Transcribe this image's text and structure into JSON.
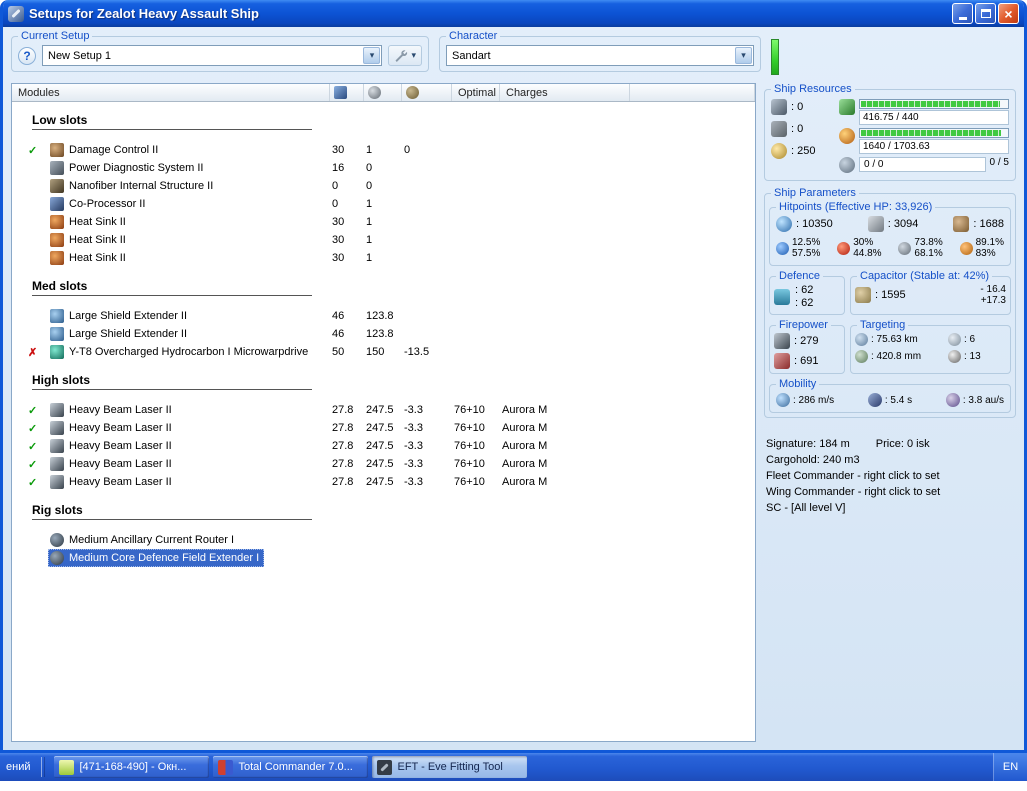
{
  "icons": {
    "close": "×",
    "dropdown_arrow": "▾",
    "help": "?",
    "check": "✓",
    "cross": "✗"
  },
  "window": {
    "title": "Setups for Zealot Heavy Assault Ship"
  },
  "toolbar": {
    "current_setup_label": "Current Setup",
    "current_setup_value": "New Setup 1",
    "character_label": "Character",
    "character_value": "Sandart"
  },
  "modules": {
    "header": {
      "title": "Modules",
      "optimal": "Optimal",
      "charges": "Charges"
    },
    "sections": [
      {
        "name": "Low slots",
        "rows": [
          {
            "status": "ok",
            "icon": "damage-control",
            "name": "Damage Control II",
            "cpu": "30",
            "pg": "1",
            "cap": "0",
            "optimal": "",
            "charge": ""
          },
          {
            "status": "",
            "icon": "power-diagnostic",
            "name": "Power Diagnostic System II",
            "cpu": "16",
            "pg": "0",
            "cap": "",
            "optimal": "",
            "charge": ""
          },
          {
            "status": "",
            "icon": "nanofiber",
            "name": "Nanofiber Internal Structure II",
            "cpu": "0",
            "pg": "0",
            "cap": "",
            "optimal": "",
            "charge": ""
          },
          {
            "status": "",
            "icon": "co-processor",
            "name": "Co-Processor II",
            "cpu": "0",
            "pg": "1",
            "cap": "",
            "optimal": "",
            "charge": ""
          },
          {
            "status": "",
            "icon": "heat-sink",
            "name": "Heat Sink II",
            "cpu": "30",
            "pg": "1",
            "cap": "",
            "optimal": "",
            "charge": ""
          },
          {
            "status": "",
            "icon": "heat-sink",
            "name": "Heat Sink II",
            "cpu": "30",
            "pg": "1",
            "cap": "",
            "optimal": "",
            "charge": ""
          },
          {
            "status": "",
            "icon": "heat-sink",
            "name": "Heat Sink II",
            "cpu": "30",
            "pg": "1",
            "cap": "",
            "optimal": "",
            "charge": ""
          }
        ]
      },
      {
        "name": "Med slots",
        "rows": [
          {
            "status": "",
            "icon": "shield-extender",
            "name": "Large Shield Extender II",
            "cpu": "46",
            "pg": "123.8",
            "cap": "",
            "optimal": "",
            "charge": ""
          },
          {
            "status": "",
            "icon": "shield-extender",
            "name": "Large Shield Extender II",
            "cpu": "46",
            "pg": "123.8",
            "cap": "",
            "optimal": "",
            "charge": ""
          },
          {
            "status": "error",
            "icon": "microwarpdrive",
            "name": "Y-T8 Overcharged Hydrocarbon I Microwarpdrive",
            "cpu": "50",
            "pg": "150",
            "cap": "-13.5",
            "optimal": "",
            "charge": ""
          }
        ]
      },
      {
        "name": "High slots",
        "rows": [
          {
            "status": "ok",
            "icon": "beam-laser",
            "name": "Heavy Beam Laser II",
            "cpu": "27.8",
            "pg": "247.5",
            "cap": "-3.3",
            "optimal": "76+10",
            "charge": "Aurora M"
          },
          {
            "status": "ok",
            "icon": "beam-laser",
            "name": "Heavy Beam Laser II",
            "cpu": "27.8",
            "pg": "247.5",
            "cap": "-3.3",
            "optimal": "76+10",
            "charge": "Aurora M"
          },
          {
            "status": "ok",
            "icon": "beam-laser",
            "name": "Heavy Beam Laser II",
            "cpu": "27.8",
            "pg": "247.5",
            "cap": "-3.3",
            "optimal": "76+10",
            "charge": "Aurora M"
          },
          {
            "status": "ok",
            "icon": "beam-laser",
            "name": "Heavy Beam Laser II",
            "cpu": "27.8",
            "pg": "247.5",
            "cap": "-3.3",
            "optimal": "76+10",
            "charge": "Aurora M"
          },
          {
            "status": "ok",
            "icon": "beam-laser",
            "name": "Heavy Beam Laser II",
            "cpu": "27.8",
            "pg": "247.5",
            "cap": "-3.3",
            "optimal": "76+10",
            "charge": "Aurora M"
          }
        ]
      },
      {
        "name": "Rig slots",
        "rows": [
          {
            "status": "",
            "icon": "rig",
            "name": "Medium Ancillary Current Router I",
            "cpu": "",
            "pg": "",
            "cap": "",
            "optimal": "",
            "charge": ""
          },
          {
            "status": "",
            "icon": "rig",
            "name": "Medium Core Defence Field Extender I",
            "cpu": "",
            "pg": "",
            "cap": "",
            "optimal": "",
            "charge": "",
            "selected": true
          }
        ]
      }
    ]
  },
  "resources": {
    "title": "Ship Resources",
    "turrets": ": 0",
    "launchers": ": 0",
    "calibration": ": 250",
    "cpu_text": "416.75 / 440",
    "pg_text": "1640 / 1703.63",
    "drone_text": "0 / 0",
    "drone_right": "0 / 5"
  },
  "parameters": {
    "title": "Ship Parameters",
    "hitpoints": {
      "title": "Hitpoints (Effective HP: 33,926)",
      "shield": ": 10350",
      "armor": ": 3094",
      "structure": ": 1688",
      "resists": [
        {
          "top": "12.5%",
          "bottom": "57.5%"
        },
        {
          "top": "30%",
          "bottom": "44.8%"
        },
        {
          "top": "73.8%",
          "bottom": "68.1%"
        },
        {
          "top": "89.1%",
          "bottom": "83%"
        }
      ]
    },
    "defence": {
      "title": "Defence",
      "v1": ": 62",
      "v2": ": 62"
    },
    "capacitor": {
      "title": "Capacitor (Stable at: 42%)",
      "amount": ": 1595",
      "drain": "- 16.4",
      "peak": "+17.3"
    },
    "firepower": {
      "title": "Firepower",
      "volley": ": 279",
      "dps": ": 691"
    },
    "targeting": {
      "title": "Targeting",
      "range": ": 75.63 km",
      "max_targets": ": 6",
      "scan_res": ": 420.8 mm",
      "sensor": ": 13"
    },
    "mobility": {
      "title": "Mobility",
      "speed": ": 286 m/s",
      "align": ": 5.4 s",
      "warp": ": 3.8 au/s"
    }
  },
  "footer": {
    "signature": "Signature: 184 m",
    "price": "Price: 0 isk",
    "cargohold": "Cargohold: 240 m3",
    "fleet": "Fleet Commander - right click to set",
    "wing": "Wing Commander - right click to set",
    "sc": "SC - [All level V]"
  },
  "taskbar": {
    "leftover": "ений",
    "buttons": [
      {
        "label": "[471-168-490] - Окн..."
      },
      {
        "label": "Total Commander 7.0..."
      },
      {
        "label": "EFT - Eve Fitting Tool"
      }
    ],
    "language": "EN"
  }
}
